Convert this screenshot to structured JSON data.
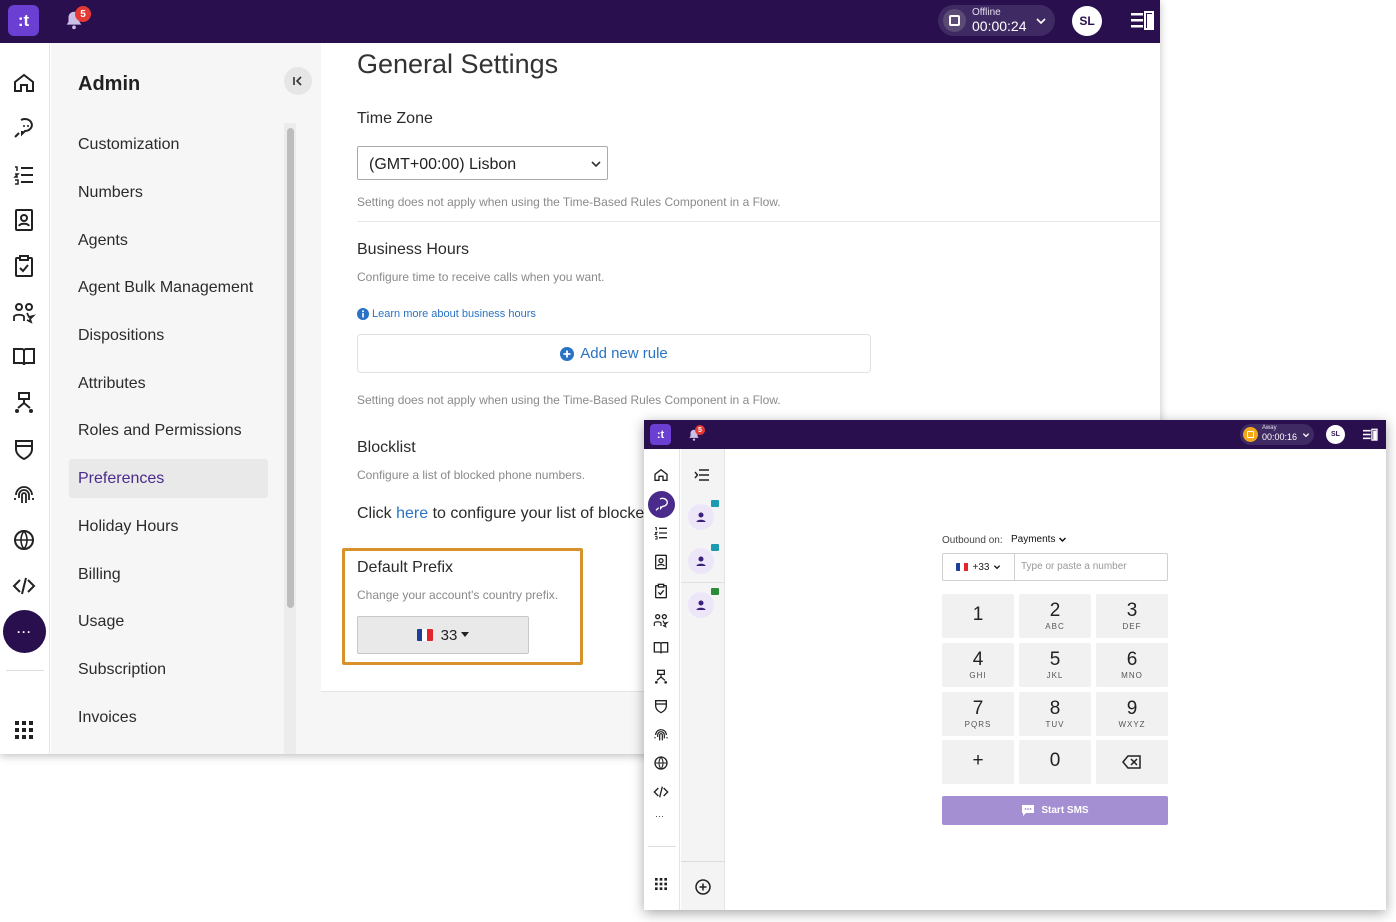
{
  "main": {
    "topbar": {
      "logo": ":t",
      "notification_count": "5",
      "status_label": "Offline",
      "status_timer": "00:00:24",
      "avatar_initials": "SL"
    },
    "rail": {
      "icons": [
        "home-icon",
        "conversations-icon",
        "list-icon",
        "contacts-icon",
        "clipboard-icon",
        "teams-icon",
        "book-icon",
        "flow-icon",
        "shield-icon",
        "fingerprint-icon",
        "globe-icon",
        "code-icon",
        "more-icon",
        "apps-grid-icon"
      ],
      "more_label": "···"
    },
    "admin_nav": {
      "title": "Admin",
      "items": [
        {
          "label": "Customization",
          "active": false
        },
        {
          "label": "Numbers",
          "active": false
        },
        {
          "label": "Agents",
          "active": false
        },
        {
          "label": "Agent Bulk Management",
          "active": false
        },
        {
          "label": "Dispositions",
          "active": false
        },
        {
          "label": "Attributes",
          "active": false
        },
        {
          "label": "Roles and Permissions",
          "active": false
        },
        {
          "label": "Preferences",
          "active": true
        },
        {
          "label": "Holiday Hours",
          "active": false
        },
        {
          "label": "Billing",
          "active": false
        },
        {
          "label": "Usage",
          "active": false
        },
        {
          "label": "Subscription",
          "active": false
        },
        {
          "label": "Invoices",
          "active": false
        }
      ]
    },
    "settings": {
      "title": "General Settings",
      "time_zone": {
        "label": "Time Zone",
        "value": "(GMT+00:00) Lisbon",
        "helper": "Setting does not apply when using the Time-Based Rules Component in a Flow."
      },
      "business_hours": {
        "label": "Business Hours",
        "description": "Configure time to receive calls when you want.",
        "learn_more": "Learn more about business hours",
        "add_rule": "Add new rule",
        "helper": "Setting does not apply when using the Time-Based Rules Component in a Flow."
      },
      "blocklist": {
        "label": "Blocklist",
        "description": "Configure a list of blocked phone numbers.",
        "text_before": "Click ",
        "link": "here",
        "text_after": " to configure your list of blocke"
      },
      "default_prefix": {
        "label": "Default Prefix",
        "description": "Change your account's country prefix.",
        "value": "33"
      }
    }
  },
  "dialer": {
    "topbar": {
      "logo": ":t",
      "notification_count": "5",
      "status_label": "Away",
      "status_timer": "00:00:16",
      "avatar_initials": "SL"
    },
    "outbound_label": "Outbound on:",
    "outbound_value": "Payments",
    "country_code": "+33",
    "number_placeholder": "Type or paste a number",
    "keys": [
      {
        "digit": "1",
        "letters": ""
      },
      {
        "digit": "2",
        "letters": "ABC"
      },
      {
        "digit": "3",
        "letters": "DEF"
      },
      {
        "digit": "4",
        "letters": "GHI"
      },
      {
        "digit": "5",
        "letters": "JKL"
      },
      {
        "digit": "6",
        "letters": "MNO"
      },
      {
        "digit": "7",
        "letters": "PQRS"
      },
      {
        "digit": "8",
        "letters": "TUV"
      },
      {
        "digit": "9",
        "letters": "WXYZ"
      },
      {
        "digit": "+",
        "letters": ""
      },
      {
        "digit": "0",
        "letters": ""
      }
    ],
    "start_sms": "Start SMS",
    "more_label": "···"
  },
  "colors": {
    "topbar": "#2a0f4f",
    "accent": "#6a3fd1",
    "link": "#2a73c4",
    "highlight": "#d9912b",
    "sms_button": "#a38fd1"
  }
}
